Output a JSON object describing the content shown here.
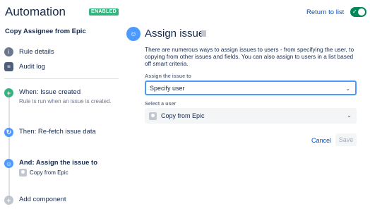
{
  "header": {
    "title": "Automation",
    "badge": "ENABLED",
    "return_link": "Return to list",
    "toggle_on": true
  },
  "sidebar": {
    "rule_name": "Copy Assignee from Epic",
    "items": [
      {
        "label": "Rule details",
        "icon": "info-icon"
      },
      {
        "label": "Audit log",
        "icon": "log-icon"
      }
    ],
    "steps": [
      {
        "title": "When: Issue created",
        "subtitle": "Rule is run when an issue is created.",
        "icon": "plus-icon",
        "color": "#36b37e"
      },
      {
        "title": "Then: Re-fetch issue data",
        "icon": "refresh-icon",
        "color": "#4c9aff"
      },
      {
        "title": "And: Assign the issue to",
        "subtitle": "Copy from Epic",
        "icon": "assign-user-icon",
        "color": "#4c9aff"
      }
    ],
    "add_component": "Add component"
  },
  "panel": {
    "title": "Assign issue",
    "description": "There are numerous ways to assign issues to users - from specifying the user, to copying from other issues and fields. You can also assign to users in a list based off smart criteria.",
    "assign_label": "Assign the issue to",
    "assign_value": "Specify user",
    "user_label": "Select a user",
    "user_value": "Copy from Epic",
    "cancel_label": "Cancel",
    "save_label": "Save"
  },
  "colors": {
    "accent": "#0052cc",
    "enabled": "#36b37e",
    "toggle": "#00875a",
    "step_blue": "#4c9aff"
  }
}
